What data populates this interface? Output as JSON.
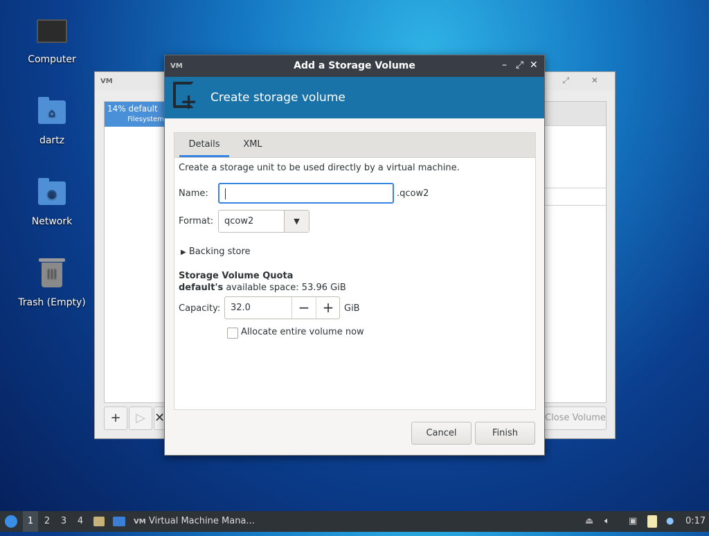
{
  "desktop": {
    "icons": [
      {
        "label": "Computer",
        "icon": "computer-icon"
      },
      {
        "label": "dartz",
        "icon": "home-folder-icon"
      },
      {
        "label": "Network",
        "icon": "network-folder-icon"
      },
      {
        "label": "Trash (Empty)",
        "icon": "trash-icon"
      }
    ]
  },
  "background_window": {
    "titlebar_logo": "VM",
    "selected_pool": {
      "usage": "14%",
      "name": "default",
      "type": "Filesystem"
    },
    "buttons": {
      "add": "+",
      "start": "▷",
      "stop": "✕",
      "close_label": "Close Volume"
    }
  },
  "dialog": {
    "title": "Add a Storage Volume",
    "titlebar_logo": "VM",
    "controls": {
      "minimize": "–",
      "maximize": "⤢",
      "close": "✕"
    },
    "banner_title": "Create storage volume",
    "tabs": [
      {
        "label": "Details",
        "active": true
      },
      {
        "label": "XML",
        "active": false
      }
    ],
    "description": "Create a storage unit to be used directly by a virtual machine.",
    "name_label": "Name:",
    "name_value": "",
    "name_suffix": ".qcow2",
    "format_label": "Format:",
    "format_value": "qcow2",
    "backing_store_label": "Backing store",
    "quota_heading": "Storage Volume Quota",
    "pool_name": "default's",
    "available_space_text": "available space: 53.96 GiB",
    "capacity_label": "Capacity:",
    "capacity_value": "32.0",
    "capacity_unit": "GiB",
    "allocate_label": "Allocate entire volume now",
    "allocate_checked": false,
    "cancel_label": "Cancel",
    "finish_label": "Finish",
    "accent_color": "#3584e4",
    "banner_color": "#1a73a8"
  },
  "taskbar": {
    "workspaces": [
      "1",
      "2",
      "3",
      "4"
    ],
    "active_workspace": "1",
    "task_label": "Virtual Machine Mana...",
    "clock": "0:17"
  }
}
